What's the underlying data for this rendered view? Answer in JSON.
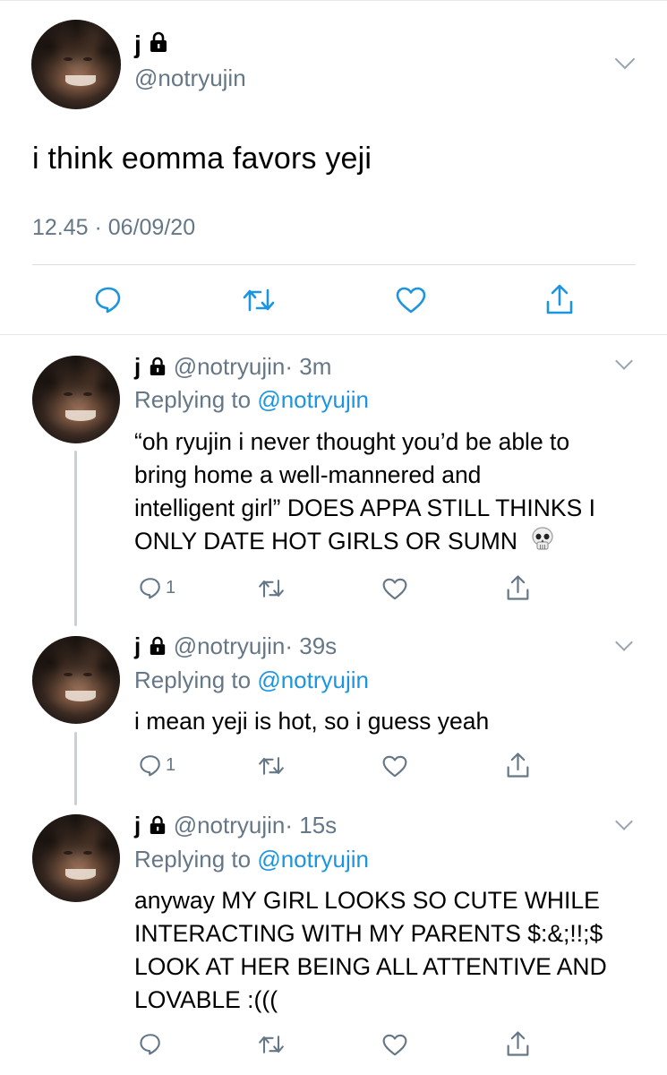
{
  "main_tweet": {
    "name": "j",
    "handle": "@notryujin",
    "text": "i think eomma favors yeji",
    "timestamp": "12.45 · 06/09/20"
  },
  "replies": [
    {
      "name": "j",
      "handle": "@notryujin",
      "time": "· 3m",
      "replying_prefix": "Replying to",
      "replying_to": "@notryujin",
      "text_lines": [
        "“oh ryujin i never thought you’d be able to",
        "bring home a well-mannered and",
        "intelligent girl” DOES APPA STILL THINKS I",
        "ONLY DATE HOT GIRLS OR SUMN"
      ],
      "emoji": "skull",
      "reply_count": "1"
    },
    {
      "name": "j",
      "handle": "@notryujin",
      "time": "· 39s",
      "replying_prefix": "Replying to",
      "replying_to": "@notryujin",
      "text_lines": [
        "i mean yeji is hot, so i guess yeah"
      ],
      "reply_count": "1"
    },
    {
      "name": "j",
      "handle": "@notryujin",
      "time": "· 15s",
      "replying_prefix": "Replying to",
      "replying_to": "@notryujin",
      "text_lines": [
        "anyway MY GIRL LOOKS SO CUTE WHILE",
        "INTERACTING WITH MY PARENTS $:&;!!;$",
        "LOOK AT HER BEING ALL ATTENTIVE AND",
        "LOVABLE :((("
      ],
      "reply_count": ""
    }
  ],
  "colors": {
    "secondary_text": "#657786",
    "link": "#1b95e0",
    "icon": "#1b95e0",
    "reply_icon": "#657786",
    "divider": "#d9dee2"
  },
  "icons": {
    "lock": "lock-icon",
    "caret": "chevron-down-icon",
    "reply": "reply-icon",
    "retweet": "retweet-icon",
    "like": "heart-icon",
    "share": "share-icon",
    "emoji": "skull-icon"
  }
}
